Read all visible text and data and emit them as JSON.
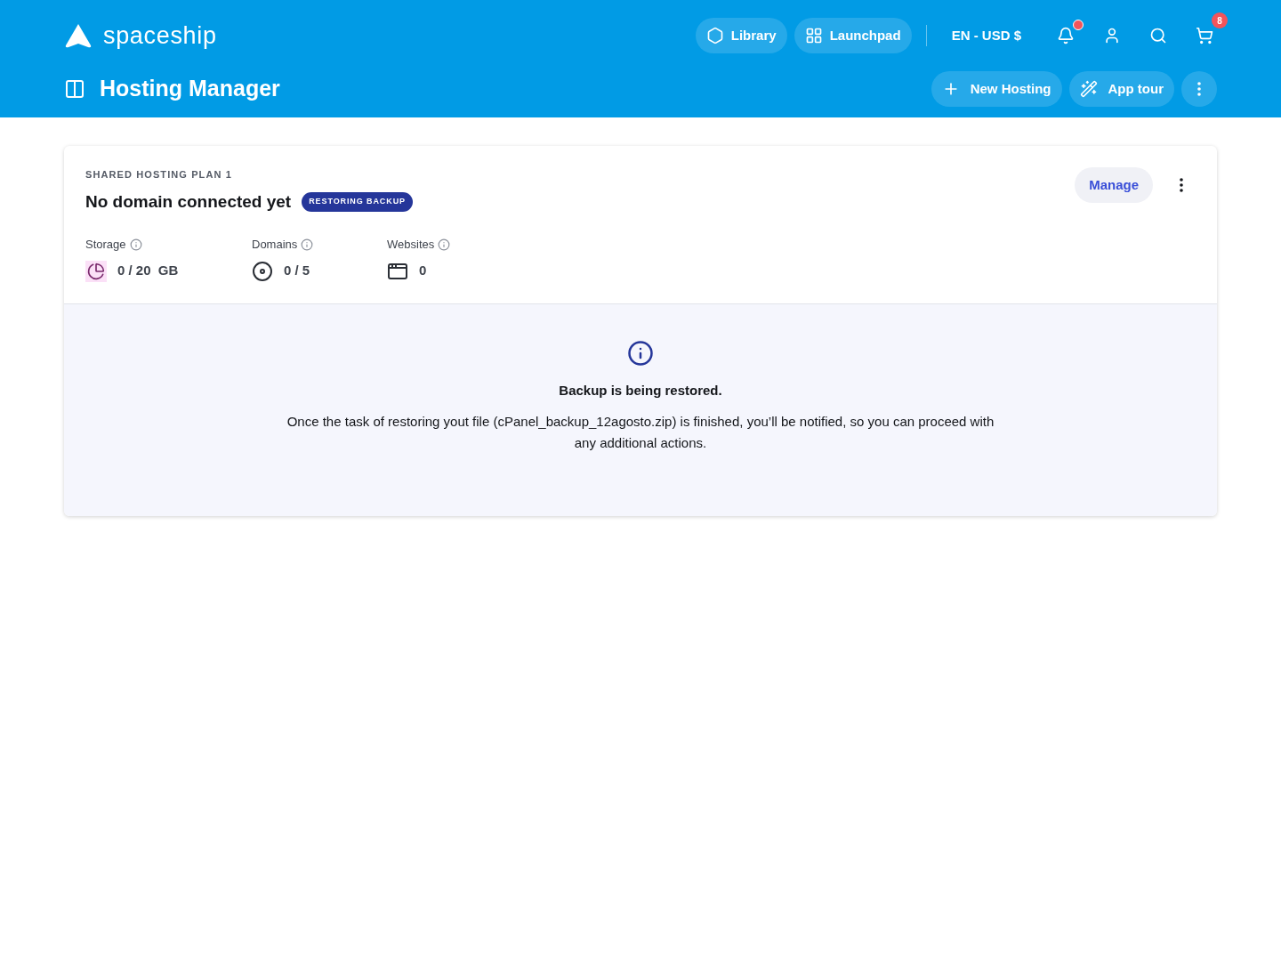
{
  "header": {
    "logo": "spaceship",
    "nav": [
      {
        "label": "Library"
      },
      {
        "label": "Launchpad"
      }
    ],
    "locale": "EN - USD $",
    "notifications": {
      "unread": true
    },
    "cart": {
      "count": "8"
    }
  },
  "page": {
    "title": "Hosting Manager",
    "actions": [
      {
        "label": "New Hosting"
      },
      {
        "label": "App tour"
      }
    ]
  },
  "plan": {
    "eyebrow": "SHARED HOSTING PLAN 1",
    "title": "No domain connected yet",
    "badge": "RESTORING BACKUP",
    "manage": "Manage",
    "stats": [
      {
        "label": "Storage",
        "value": "0 / 20  GB"
      },
      {
        "label": "Domains",
        "value": "0 / 5"
      },
      {
        "label": "Websites",
        "value": "0"
      }
    ],
    "notice": {
      "title": "Backup is being restored.",
      "text": "Once the task of restoring yout file (cPanel_backup_12agosto.zip) is finished, you’ll be notified, so you can proceed with any additional actions."
    }
  }
}
